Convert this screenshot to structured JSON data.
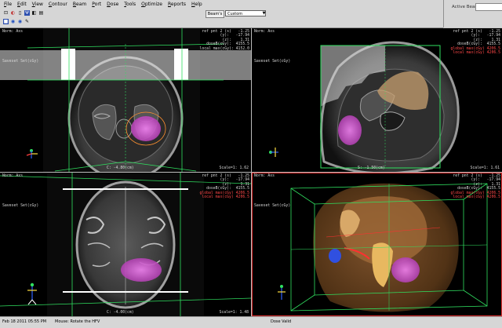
{
  "menu": [
    "File",
    "Edit",
    "View",
    "Contour",
    "Beam",
    "Port",
    "Dose",
    "Tools",
    "Optimize",
    "Reports",
    "Help"
  ],
  "toolbar": {
    "row1_glyphs": [
      "⊡",
      "◐",
      "▯",
      "Ψ",
      "◧",
      "▤"
    ],
    "row2_glyphs": [
      "■",
      "◉",
      "◉",
      "✎"
    ],
    "view_label": "Beam's",
    "view_value": "Custom",
    "arrow": "▼"
  },
  "right_panel": {
    "active_beams_label": "Active Beams:"
  },
  "viewports": {
    "axial": {
      "norm": "Norm: Axs",
      "series": "Saveset Set(cGy)",
      "ref_lines": "ref pnt 2 (s)   -1.25\n         (y):   -17.94\n         (z):    1.31\n    doseB(cGy):  4155.5\n  local max(cGy): 4152.0",
      "red_line": "local max(cGy) 4152.0",
      "slice": "C: -4.80(cm)",
      "scale": "Scale=1: 1.62"
    },
    "sagittal": {
      "norm": "Norm: Axs",
      "series": "Saveset Set(cGy)",
      "ref_lines": "ref pnt 2 (s)   -1.25\n         (y):   -17.94\n         (z):    1.31\n    doseB(cGy):  4155.5",
      "red_line": "global max(cGy) 4206.5\nlocal max(cGy) 4206.5",
      "slice": "S: -1.50(cm)",
      "scale": "Scale=1: 1.61"
    },
    "coronal": {
      "norm": "Norm: Axs",
      "series": "Saveset Set(cGy)",
      "ref_lines": "ref pnt 2 (s)   -1.25\n         (y):   -17.94\n         (z):    1.31\n    doseB(cGy):  4155.5",
      "red_line": "global max(cGy) 4206.5\nlocal max(cGy) 4206.5",
      "slice": "C: -4.00(cm)",
      "scale": "Scale=1: 1.48"
    },
    "three_d": {
      "norm": "Norm: Axs",
      "series": "Saveset Set(cGy)",
      "ref_lines": "ref pnt 2 (s)   -1.25\n         (y):   -17.94\n         (z):    1.31\n    doseB(cGy):  4155.5",
      "red_line": "global max(cGy) 4206.5\nlocal max(cGy) 4206.5"
    }
  },
  "status": {
    "time": "Feb 18 2011 05:55 PM",
    "mouse": "Mouse:   Rotate the HFV",
    "dose_valid": "Dose Valid"
  },
  "colors": {
    "dose_magenta": "#d050d0",
    "beam_green": "#30e060",
    "target_red": "#ff4848",
    "tissue": "#c8a070"
  }
}
